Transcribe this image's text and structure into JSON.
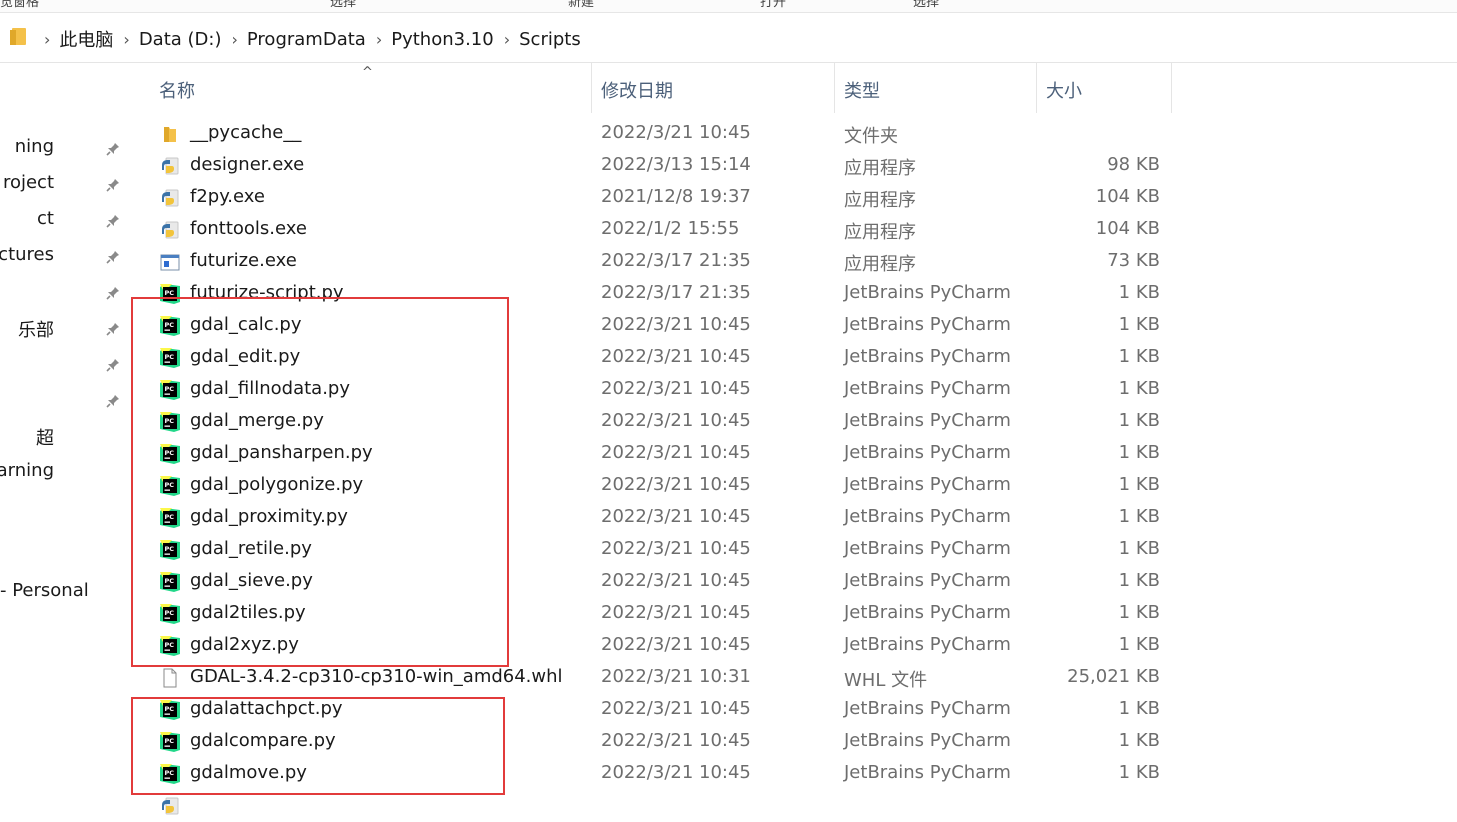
{
  "ribbon": {
    "fragments": [
      "览窗格",
      "选择",
      "新建",
      "打开",
      "选择"
    ]
  },
  "address_bar": {
    "breadcrumbs": [
      "此电脑",
      "Data (D:)",
      "ProgramData",
      "Python3.10",
      "Scripts"
    ]
  },
  "nav_pane": {
    "items": [
      {
        "label": "ning",
        "pinned": true
      },
      {
        "label": "roject",
        "pinned": true
      },
      {
        "label": "ct",
        "pinned": true
      },
      {
        "label": "ctures",
        "pinned": true
      },
      {
        "label": "",
        "pinned": true
      },
      {
        "label": "乐部",
        "pinned": true
      },
      {
        "label": "",
        "pinned": true
      },
      {
        "label": "",
        "pinned": true
      },
      {
        "label": "超",
        "pinned": false
      },
      {
        "label": "earning",
        "pinned": false
      },
      {
        "label": "- Personal",
        "pinned": false
      }
    ]
  },
  "columns": {
    "name": "名称",
    "date": "修改日期",
    "type": "类型",
    "size": "大小"
  },
  "files": [
    {
      "name": "__pycache__",
      "date": "2022/3/21 10:45",
      "type": "文件夹",
      "size": "",
      "icon": "folder"
    },
    {
      "name": "designer.exe",
      "date": "2022/3/13 15:14",
      "type": "应用程序",
      "size": "98 KB",
      "icon": "python-exe"
    },
    {
      "name": "f2py.exe",
      "date": "2021/12/8 19:37",
      "type": "应用程序",
      "size": "104 KB",
      "icon": "python-exe"
    },
    {
      "name": "fonttools.exe",
      "date": "2022/1/2 15:55",
      "type": "应用程序",
      "size": "104 KB",
      "icon": "python-exe"
    },
    {
      "name": "futurize.exe",
      "date": "2022/3/17 21:35",
      "type": "应用程序",
      "size": "73 KB",
      "icon": "window-exe"
    },
    {
      "name": "futurize-script.py",
      "date": "2022/3/17 21:35",
      "type": "JetBrains PyCharm",
      "size": "1 KB",
      "icon": "pycharm"
    },
    {
      "name": "gdal_calc.py",
      "date": "2022/3/21 10:45",
      "type": "JetBrains PyCharm",
      "size": "1 KB",
      "icon": "pycharm"
    },
    {
      "name": "gdal_edit.py",
      "date": "2022/3/21 10:45",
      "type": "JetBrains PyCharm",
      "size": "1 KB",
      "icon": "pycharm"
    },
    {
      "name": "gdal_fillnodata.py",
      "date": "2022/3/21 10:45",
      "type": "JetBrains PyCharm",
      "size": "1 KB",
      "icon": "pycharm"
    },
    {
      "name": "gdal_merge.py",
      "date": "2022/3/21 10:45",
      "type": "JetBrains PyCharm",
      "size": "1 KB",
      "icon": "pycharm"
    },
    {
      "name": "gdal_pansharpen.py",
      "date": "2022/3/21 10:45",
      "type": "JetBrains PyCharm",
      "size": "1 KB",
      "icon": "pycharm"
    },
    {
      "name": "gdal_polygonize.py",
      "date": "2022/3/21 10:45",
      "type": "JetBrains PyCharm",
      "size": "1 KB",
      "icon": "pycharm"
    },
    {
      "name": "gdal_proximity.py",
      "date": "2022/3/21 10:45",
      "type": "JetBrains PyCharm",
      "size": "1 KB",
      "icon": "pycharm"
    },
    {
      "name": "gdal_retile.py",
      "date": "2022/3/21 10:45",
      "type": "JetBrains PyCharm",
      "size": "1 KB",
      "icon": "pycharm"
    },
    {
      "name": "gdal_sieve.py",
      "date": "2022/3/21 10:45",
      "type": "JetBrains PyCharm",
      "size": "1 KB",
      "icon": "pycharm"
    },
    {
      "name": "gdal2tiles.py",
      "date": "2022/3/21 10:45",
      "type": "JetBrains PyCharm",
      "size": "1 KB",
      "icon": "pycharm"
    },
    {
      "name": "gdal2xyz.py",
      "date": "2022/3/21 10:45",
      "type": "JetBrains PyCharm",
      "size": "1 KB",
      "icon": "pycharm"
    },
    {
      "name": "GDAL-3.4.2-cp310-cp310-win_amd64.whl",
      "date": "2022/3/21 10:31",
      "type": "WHL 文件",
      "size": "25,021 KB",
      "icon": "document"
    },
    {
      "name": "gdalattachpct.py",
      "date": "2022/3/21 10:45",
      "type": "JetBrains PyCharm",
      "size": "1 KB",
      "icon": "pycharm"
    },
    {
      "name": "gdalcompare.py",
      "date": "2022/3/21 10:45",
      "type": "JetBrains PyCharm",
      "size": "1 KB",
      "icon": "pycharm"
    },
    {
      "name": "gdalmove.py",
      "date": "2022/3/21 10:45",
      "type": "JetBrains PyCharm",
      "size": "1 KB",
      "icon": "pycharm"
    },
    {
      "name": "",
      "date": "",
      "type": "",
      "size": "",
      "icon": "python-exe"
    }
  ],
  "highlight_color": "#e23b3b",
  "highlight_groups": [
    {
      "first_file": "gdal_calc.py",
      "last_file": "gdal2xyz.py"
    },
    {
      "first_file": "gdalattachpct.py",
      "last_file": "gdalmove.py"
    }
  ]
}
